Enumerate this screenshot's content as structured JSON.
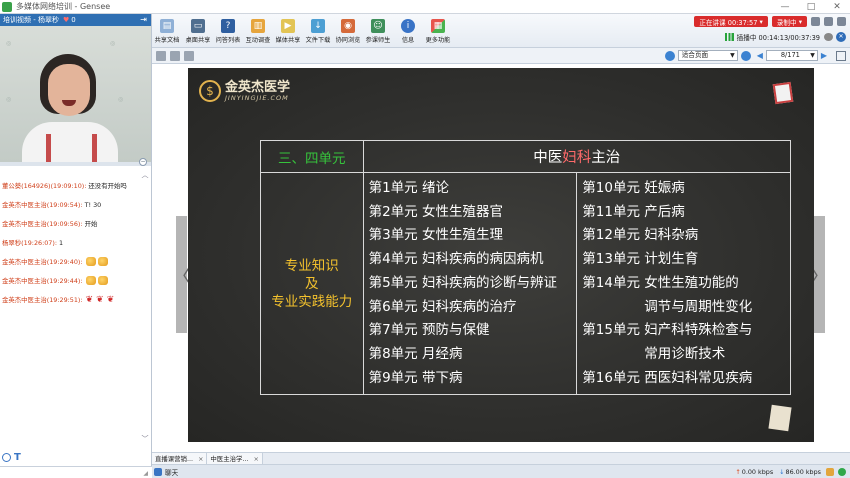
{
  "window": {
    "title": "多媒体网络培训 - Gensee",
    "minimize": "—",
    "maximize": "□",
    "close": "✕"
  },
  "left_panel": {
    "header_title": "培训视频 - 杨翠秒",
    "heart_count": "0",
    "chat_messages": [
      {
        "sender": "董公葵",
        "id": "(164926)",
        "time": "(19:09:10)",
        "text": "还没有开始吗",
        "emoji": ""
      },
      {
        "sender": "金英杰中医主治",
        "id": "",
        "time": "(19:09:54)",
        "text": "T! 30",
        "emoji": ""
      },
      {
        "sender": "金英杰中医主治",
        "id": "",
        "time": "(19:09:56)",
        "text": "开始",
        "emoji": ""
      },
      {
        "sender": "杨翠秒",
        "id": "",
        "time": "(19:26:07)",
        "text": "1",
        "emoji": ""
      },
      {
        "sender": "金英杰中医主治",
        "id": "",
        "time": "(19:29:40)",
        "text": "",
        "emoji": "clap"
      },
      {
        "sender": "金英杰中医主治",
        "id": "",
        "time": "(19:29:44)",
        "text": "",
        "emoji": "clap"
      },
      {
        "sender": "金英杰中医主治",
        "id": "",
        "time": "(19:29:51)",
        "text": "",
        "emoji": "rose"
      }
    ],
    "chat_tool_text": "T"
  },
  "toolbar": {
    "tools": [
      {
        "id": "tool-docs",
        "label": "共享文档",
        "icon": "doc-icon"
      },
      {
        "id": "tool-desktop",
        "label": "桌面共享",
        "icon": "desktop-icon"
      },
      {
        "id": "tool-quiz",
        "label": "问答列表",
        "icon": "qa-icon"
      },
      {
        "id": "tool-interact",
        "label": "互动调查",
        "icon": "survey-icon"
      },
      {
        "id": "tool-media",
        "label": "媒体共享",
        "icon": "media-icon"
      },
      {
        "id": "tool-files",
        "label": "文件下载",
        "icon": "download-icon"
      },
      {
        "id": "tool-browse",
        "label": "协同浏览",
        "icon": "browse-icon"
      },
      {
        "id": "tool-online",
        "label": "参课师生",
        "icon": "users-icon"
      },
      {
        "id": "tool-info",
        "label": "信息",
        "icon": "info-icon"
      },
      {
        "id": "tool-more",
        "label": "更多功能",
        "icon": "more-icon"
      }
    ],
    "speaking_label": "正在讲课 00:37:57",
    "recording_label": "录制中",
    "live_status": "插播中 00:14:13/00:37:39"
  },
  "doc_nav": {
    "fit_mode": "适合页面",
    "page_indicator": "8/171"
  },
  "slide": {
    "logo_name": "金英杰医学",
    "logo_domain": "JINYINGJIE.COM",
    "table": {
      "unit_header": "三、四单元",
      "title_prefix": "中医",
      "title_highlight": "妇科",
      "title_suffix": "主治",
      "left_line1": "专业知识",
      "left_line2": "及",
      "left_line3": "专业实践能力",
      "col1": [
        "第1单元 绪论",
        "第2单元 女性生殖器官",
        "第3单元 女性生殖生理",
        "第4单元 妇科疾病的病因病机",
        "第5单元 妇科疾病的诊断与辨证",
        "第6单元 妇科疾病的治疗",
        "第7单元 预防与保健",
        "第8单元 月经病",
        "第9单元 带下病"
      ],
      "col2": [
        "第10单元 妊娠病",
        "第11单元 产后病",
        "第12单元 妇科杂病",
        "第13单元 计划生育",
        "第14单元 女性生殖功能的",
        "调节与周期性变化",
        "第15单元 妇产科特殊检查与",
        "常用诊断技术",
        "第16单元 西医妇科常见疾病"
      ]
    },
    "prev_arrow": "〈",
    "next_arrow": "〉"
  },
  "tabs": [
    {
      "label": "直播课营销..."
    },
    {
      "label": "中医主治学..."
    }
  ],
  "statusbar": {
    "chat_label": "聊天",
    "upload_rate": "0.00 kbps",
    "download_rate": "86.00 kbps"
  }
}
